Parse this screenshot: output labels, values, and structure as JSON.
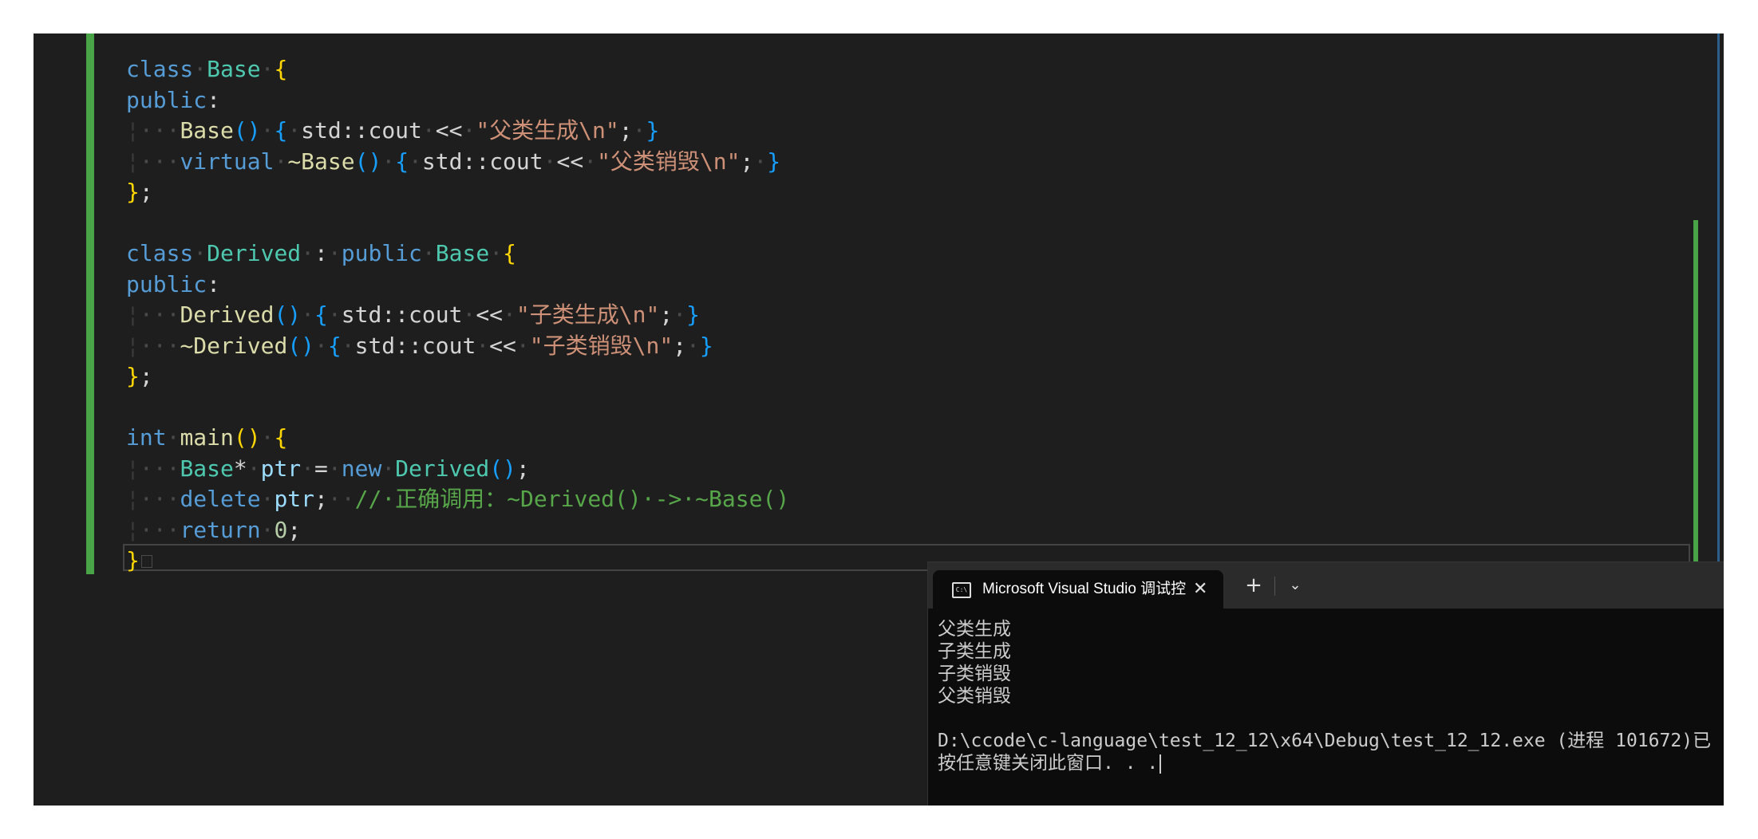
{
  "editor": {
    "lines": [
      [
        {
          "t": "class",
          "c": "kw"
        },
        {
          "t": "·",
          "c": "ws"
        },
        {
          "t": "Base",
          "c": "ty"
        },
        {
          "t": "·",
          "c": "ws"
        },
        {
          "t": "{",
          "c": "b1"
        }
      ],
      [
        {
          "t": "public",
          "c": "kw"
        },
        {
          "t": ":"
        }
      ],
      [
        {
          "t": "¦",
          "c": "guide"
        },
        {
          "t": "···",
          "c": "ws"
        },
        {
          "t": "Base",
          "c": "fn"
        },
        {
          "t": "()",
          "c": "b2"
        },
        {
          "t": "·",
          "c": "ws"
        },
        {
          "t": "{",
          "c": "b2"
        },
        {
          "t": "·",
          "c": "ws"
        },
        {
          "t": "std::cout"
        },
        {
          "t": "·",
          "c": "ws"
        },
        {
          "t": "<<"
        },
        {
          "t": "·",
          "c": "ws"
        },
        {
          "t": "\"父类生成\\n\"",
          "c": "str"
        },
        {
          "t": ";"
        },
        {
          "t": "·",
          "c": "ws"
        },
        {
          "t": "}",
          "c": "b2"
        }
      ],
      [
        {
          "t": "¦",
          "c": "guide"
        },
        {
          "t": "···",
          "c": "ws"
        },
        {
          "t": "virtual",
          "c": "kw"
        },
        {
          "t": "·",
          "c": "ws"
        },
        {
          "t": "~Base",
          "c": "fn"
        },
        {
          "t": "()",
          "c": "b2"
        },
        {
          "t": "·",
          "c": "ws"
        },
        {
          "t": "{",
          "c": "b2"
        },
        {
          "t": "·",
          "c": "ws"
        },
        {
          "t": "std::cout"
        },
        {
          "t": "·",
          "c": "ws"
        },
        {
          "t": "<<"
        },
        {
          "t": "·",
          "c": "ws"
        },
        {
          "t": "\"父类销毁\\n\"",
          "c": "str"
        },
        {
          "t": ";"
        },
        {
          "t": "·",
          "c": "ws"
        },
        {
          "t": "}",
          "c": "b2"
        }
      ],
      [
        {
          "t": "}",
          "c": "b1"
        },
        {
          "t": ";"
        }
      ],
      [],
      [
        {
          "t": "class",
          "c": "kw"
        },
        {
          "t": "·",
          "c": "ws"
        },
        {
          "t": "Derived",
          "c": "ty"
        },
        {
          "t": "·",
          "c": "ws"
        },
        {
          "t": ":"
        },
        {
          "t": "·",
          "c": "ws"
        },
        {
          "t": "public",
          "c": "kw"
        },
        {
          "t": "·",
          "c": "ws"
        },
        {
          "t": "Base",
          "c": "ty"
        },
        {
          "t": "·",
          "c": "ws"
        },
        {
          "t": "{",
          "c": "b1"
        }
      ],
      [
        {
          "t": "public",
          "c": "kw"
        },
        {
          "t": ":"
        }
      ],
      [
        {
          "t": "¦",
          "c": "guide"
        },
        {
          "t": "···",
          "c": "ws"
        },
        {
          "t": "Derived",
          "c": "fn"
        },
        {
          "t": "()",
          "c": "b2"
        },
        {
          "t": "·",
          "c": "ws"
        },
        {
          "t": "{",
          "c": "b2"
        },
        {
          "t": "·",
          "c": "ws"
        },
        {
          "t": "std::cout"
        },
        {
          "t": "·",
          "c": "ws"
        },
        {
          "t": "<<"
        },
        {
          "t": "·",
          "c": "ws"
        },
        {
          "t": "\"子类生成\\n\"",
          "c": "str"
        },
        {
          "t": ";"
        },
        {
          "t": "·",
          "c": "ws"
        },
        {
          "t": "}",
          "c": "b2"
        }
      ],
      [
        {
          "t": "¦",
          "c": "guide"
        },
        {
          "t": "···",
          "c": "ws"
        },
        {
          "t": "~Derived",
          "c": "fn"
        },
        {
          "t": "()",
          "c": "b2"
        },
        {
          "t": "·",
          "c": "ws"
        },
        {
          "t": "{",
          "c": "b2"
        },
        {
          "t": "·",
          "c": "ws"
        },
        {
          "t": "std::cout"
        },
        {
          "t": "·",
          "c": "ws"
        },
        {
          "t": "<<"
        },
        {
          "t": "·",
          "c": "ws"
        },
        {
          "t": "\"子类销毁\\n\"",
          "c": "str"
        },
        {
          "t": ";"
        },
        {
          "t": "·",
          "c": "ws"
        },
        {
          "t": "}",
          "c": "b2"
        }
      ],
      [
        {
          "t": "}",
          "c": "b1"
        },
        {
          "t": ";"
        }
      ],
      [],
      [
        {
          "t": "int",
          "c": "kw"
        },
        {
          "t": "·",
          "c": "ws"
        },
        {
          "t": "main",
          "c": "fn"
        },
        {
          "t": "()",
          "c": "b1"
        },
        {
          "t": "·",
          "c": "ws"
        },
        {
          "t": "{",
          "c": "b1"
        }
      ],
      [
        {
          "t": "¦",
          "c": "guide"
        },
        {
          "t": "···",
          "c": "ws"
        },
        {
          "t": "Base",
          "c": "ty"
        },
        {
          "t": "*"
        },
        {
          "t": "·",
          "c": "ws"
        },
        {
          "t": "ptr",
          "c": "var"
        },
        {
          "t": "·",
          "c": "ws"
        },
        {
          "t": "="
        },
        {
          "t": "·",
          "c": "ws"
        },
        {
          "t": "new",
          "c": "kw"
        },
        {
          "t": "·",
          "c": "ws"
        },
        {
          "t": "Derived",
          "c": "ty"
        },
        {
          "t": "()",
          "c": "b2"
        },
        {
          "t": ";"
        }
      ],
      [
        {
          "t": "¦",
          "c": "guide"
        },
        {
          "t": "···",
          "c": "ws"
        },
        {
          "t": "delete",
          "c": "kw"
        },
        {
          "t": "·",
          "c": "ws"
        },
        {
          "t": "ptr",
          "c": "var"
        },
        {
          "t": ";"
        },
        {
          "t": "··",
          "c": "ws"
        },
        {
          "t": "//·正确调用：~Derived()·->·~Base()",
          "c": "com"
        }
      ],
      [
        {
          "t": "¦",
          "c": "guide"
        },
        {
          "t": "···",
          "c": "ws"
        },
        {
          "t": "return",
          "c": "kw"
        },
        {
          "t": "·",
          "c": "ws"
        },
        {
          "t": "0",
          "c": "num"
        },
        {
          "t": ";"
        }
      ],
      [
        {
          "t": "}",
          "c": "b1"
        }
      ]
    ]
  },
  "terminal": {
    "tab_title": "Microsoft Visual Studio 调试控",
    "tab_icon_text": "C:\\",
    "close_glyph": "✕",
    "new_tab_glyph": "+",
    "dropdown_glyph": "⌄",
    "output": {
      "line1": "父类生成",
      "line2": "子类生成",
      "line3": "子类销毁",
      "line4": "父类销毁",
      "exit_line": "D:\\ccode\\c-language\\test_12_12\\x64\\Debug\\test_12_12.exe (进程 101672)已",
      "prompt": "按任意键关闭此窗口. . ."
    }
  }
}
